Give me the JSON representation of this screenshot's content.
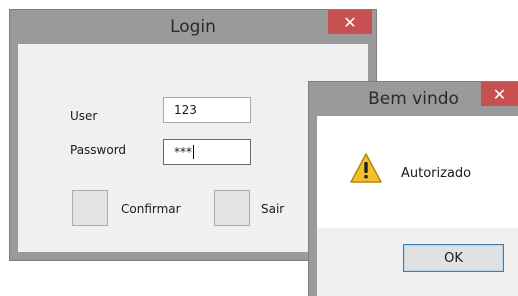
{
  "login": {
    "title": "Login",
    "close_glyph": "✕",
    "user_label": "User",
    "user_value": "123",
    "password_label": "Password",
    "password_value": "***",
    "confirm_label": "Confirmar",
    "exit_label": "Sair"
  },
  "dialog": {
    "title": "Bem vindo",
    "close_glyph": "✕",
    "message": "Autorizado",
    "ok_label": "OK",
    "icon": "warning-icon"
  },
  "colors": {
    "frame": "#9a9a9a",
    "close_button": "#c75050",
    "client": "#f0f0f0",
    "warning": "#f2c12e"
  }
}
